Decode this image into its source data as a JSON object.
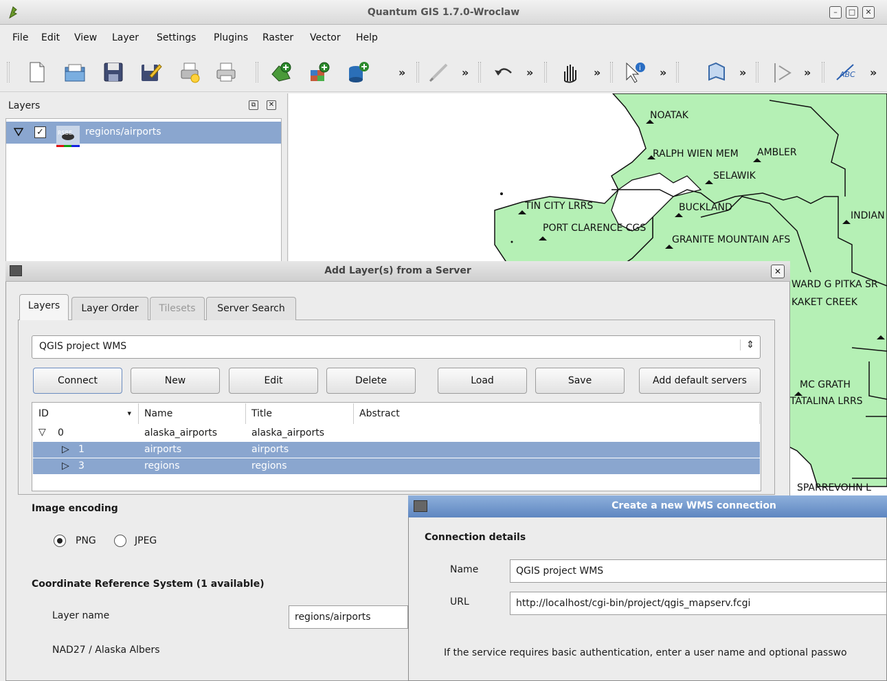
{
  "window": {
    "title": "Quantum GIS 1.7.0-Wroclaw"
  },
  "menubar": [
    "File",
    "Edit",
    "View",
    "Layer",
    "Settings",
    "Plugins",
    "Raster",
    "Vector",
    "Help"
  ],
  "toolbar": {
    "more": "»"
  },
  "layers_panel": {
    "title": "Layers",
    "layer_name": "regions/airports",
    "layer_icon_text": "RSBE"
  },
  "map": {
    "labels": [
      "NOATAK",
      "RALPH WIEN MEM",
      "AMBLER",
      "SELAWIK",
      "TIN CITY LRRS",
      "BUCKLAND",
      "INDIAN",
      "PORT CLARENCE CGS",
      "GRANITE MOUNTAIN AFS",
      "WARD G PITKA SR",
      "KAKET CREEK",
      "MC GRATH",
      "TATALINA LRRS",
      "SPARREVOHN L"
    ],
    "colors": {
      "land": "#b5f0b5",
      "border": "#111111"
    }
  },
  "add_dialog": {
    "title": "Add Layer(s) from a Server",
    "tabs": [
      "Layers",
      "Layer Order",
      "Tilesets",
      "Server Search"
    ],
    "server_select": "QGIS project WMS",
    "buttons": {
      "connect": "Connect",
      "new": "New",
      "edit": "Edit",
      "delete": "Delete",
      "load": "Load",
      "save": "Save",
      "add_default": "Add default servers"
    },
    "table": {
      "headers": [
        "ID",
        "Name",
        "Title",
        "Abstract"
      ],
      "rows": [
        {
          "id": "0",
          "name": "alaska_airports",
          "title": "alaska_airports"
        },
        {
          "id": "1",
          "name": "airports",
          "title": "airports"
        },
        {
          "id": "3",
          "name": "regions",
          "title": "regions"
        }
      ]
    },
    "image_encoding": {
      "title": "Image encoding",
      "png": "PNG",
      "jpeg": "JPEG",
      "selected": "PNG"
    },
    "crs": {
      "title": "Coordinate Reference System (1 available)",
      "name": "NAD27 / Alaska Albers"
    },
    "layer_name": {
      "label": "Layer name",
      "value": "regions/airports"
    }
  },
  "wms_dialog": {
    "title": "Create a new WMS connection",
    "section": "Connection details",
    "name_label": "Name",
    "name_value": "QGIS project WMS",
    "url_label": "URL",
    "url_value": "http://localhost/cgi-bin/project/qgis_mapserv.fcgi",
    "auth_text": "If the service requires basic authentication, enter a user name and optional passwo"
  },
  "colors": {
    "selection": "#8aa6cf",
    "titlebar_active": "#6b90c7"
  }
}
